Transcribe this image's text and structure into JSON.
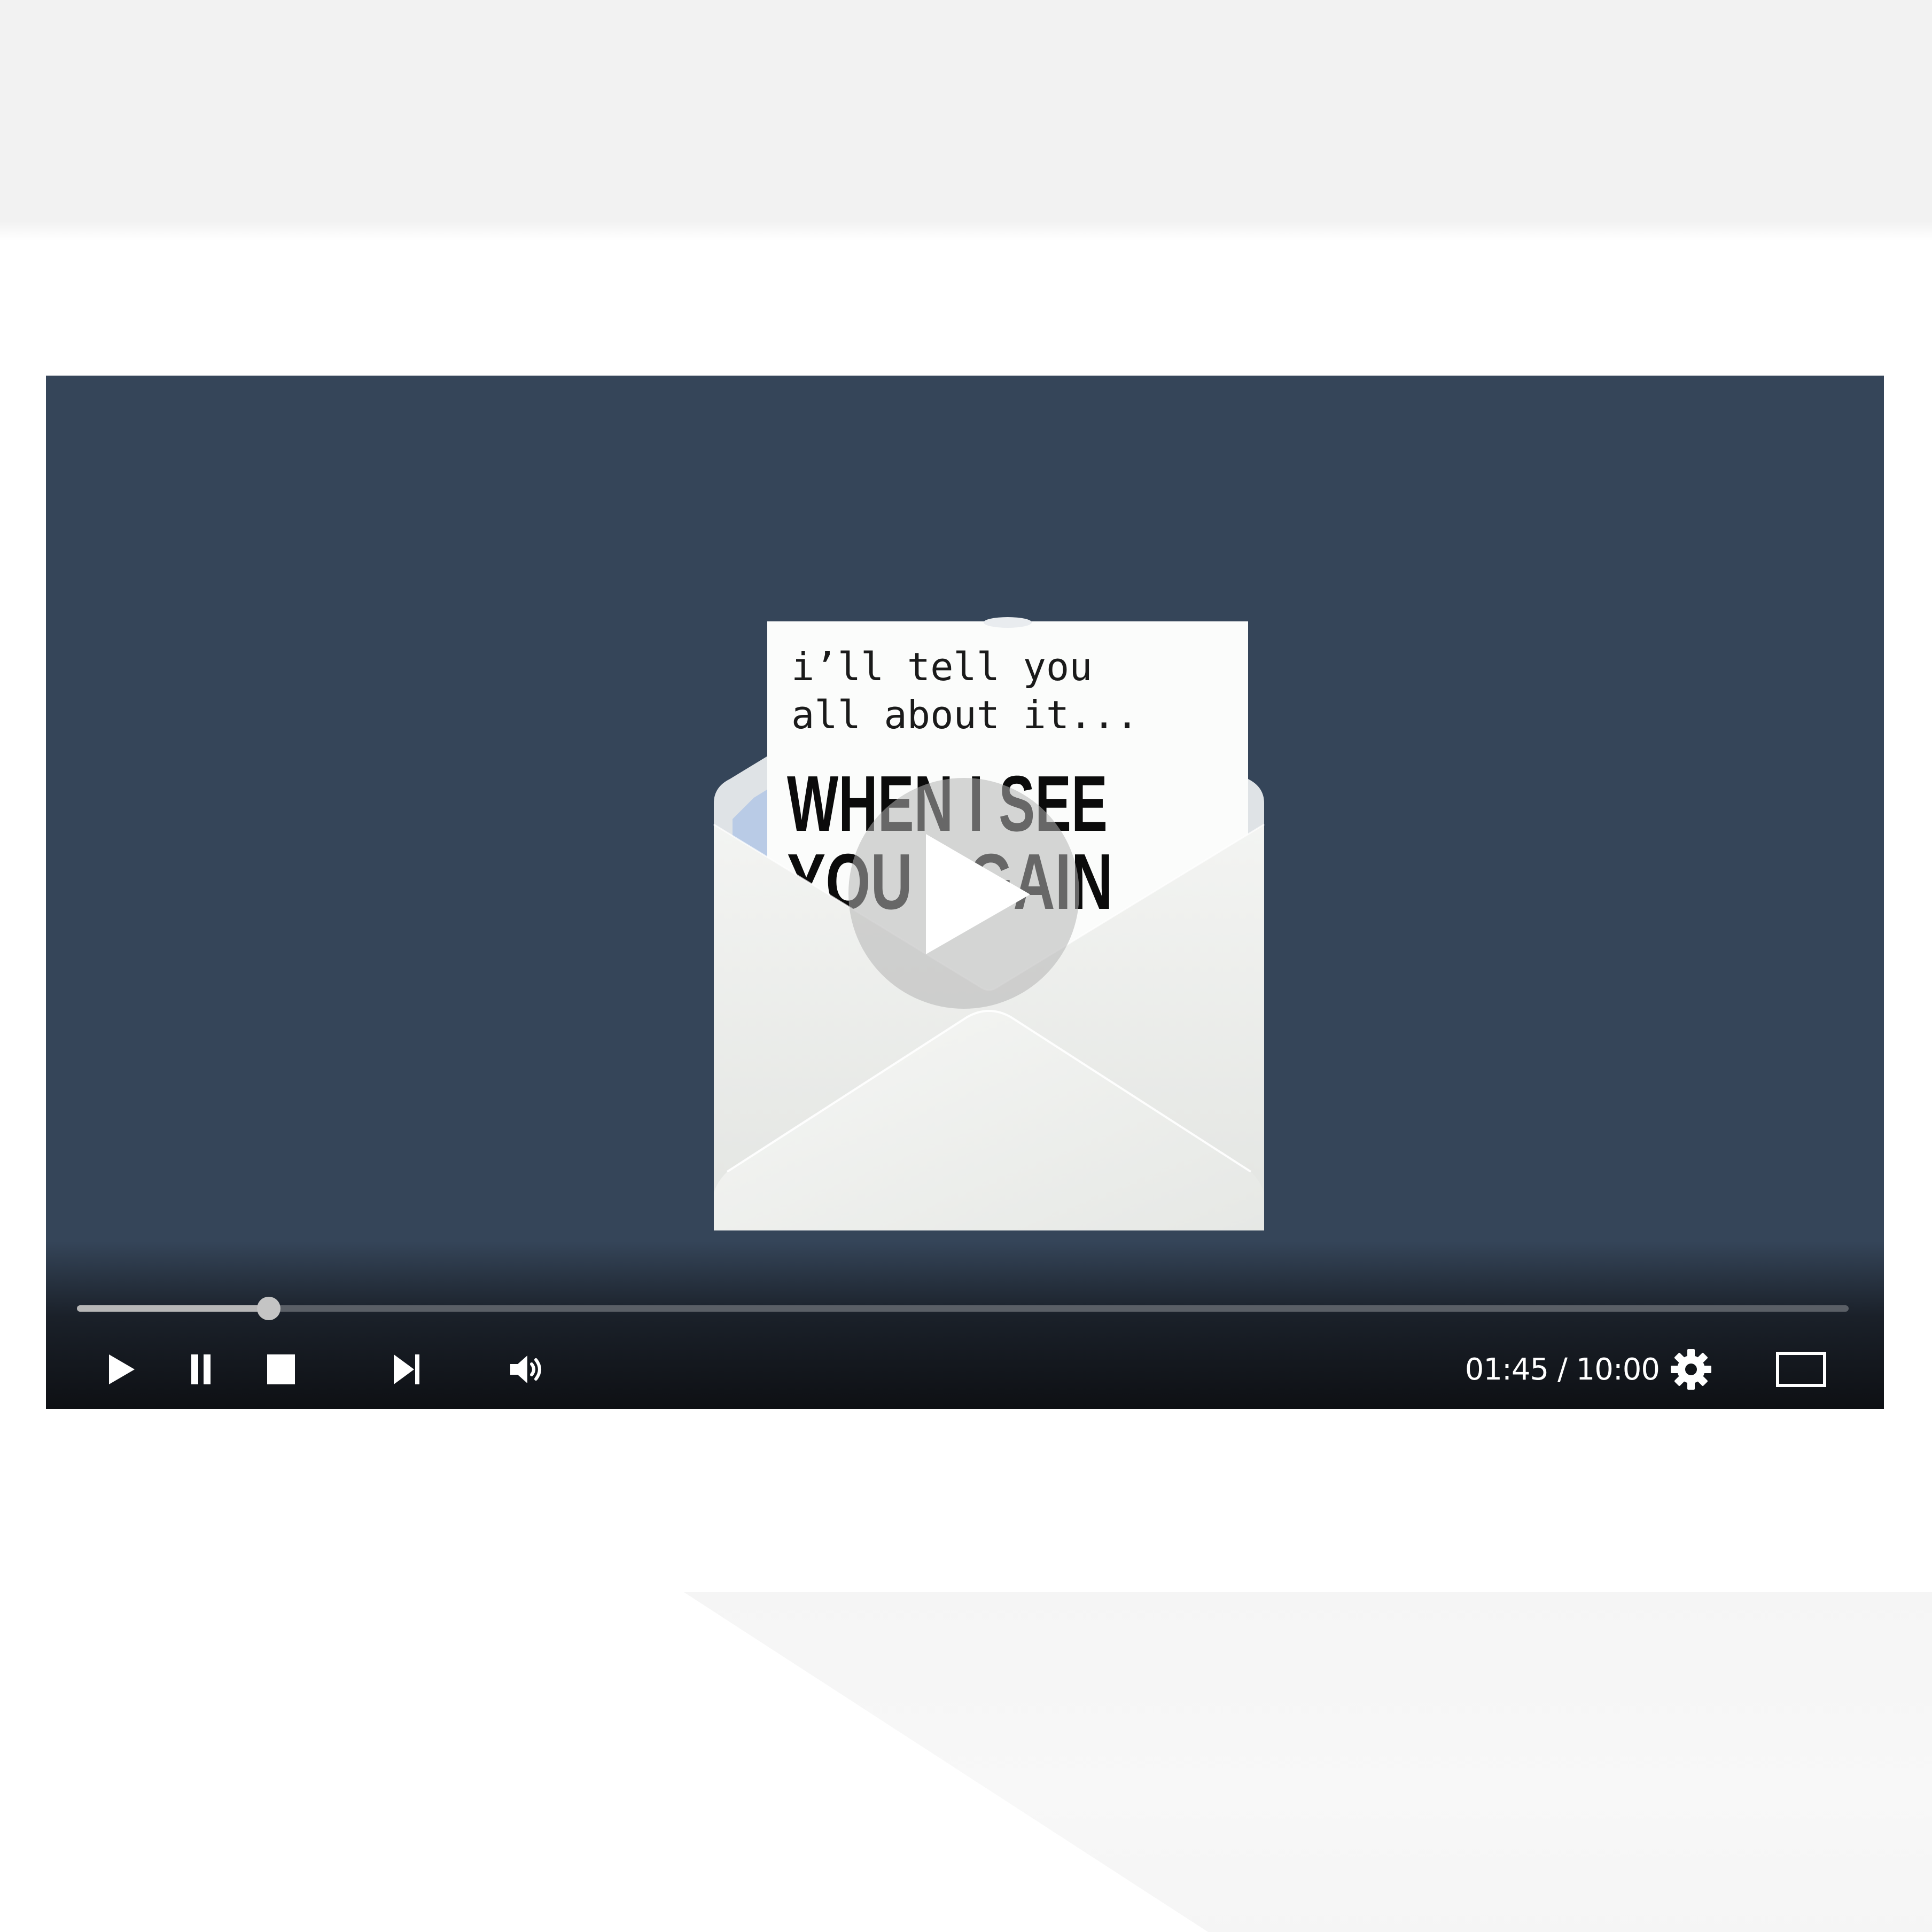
{
  "player": {
    "poster": {
      "note_line1": "i’ll tell you",
      "note_line2": "all about it...",
      "title_line1": "WHEN I SEE",
      "title_line2": "YOU AGAIN"
    },
    "progress": {
      "fraction": 0.1083
    },
    "time": {
      "current": "01:45",
      "separator": " / ",
      "total": "10:00"
    },
    "controls": {
      "play_icon": "play-icon",
      "pause_icon": "pause-icon",
      "stop_icon": "stop-icon",
      "next_icon": "skip-next-icon",
      "volume_icon": "volume-icon",
      "settings_icon": "gear-icon",
      "fullscreen_icon": "fullscreen-icon"
    },
    "colors": {
      "video_background": "#354559",
      "control_bar": "#0e1014",
      "progress_played": "#b7b7b7",
      "progress_track": "#5a5f66"
    }
  }
}
